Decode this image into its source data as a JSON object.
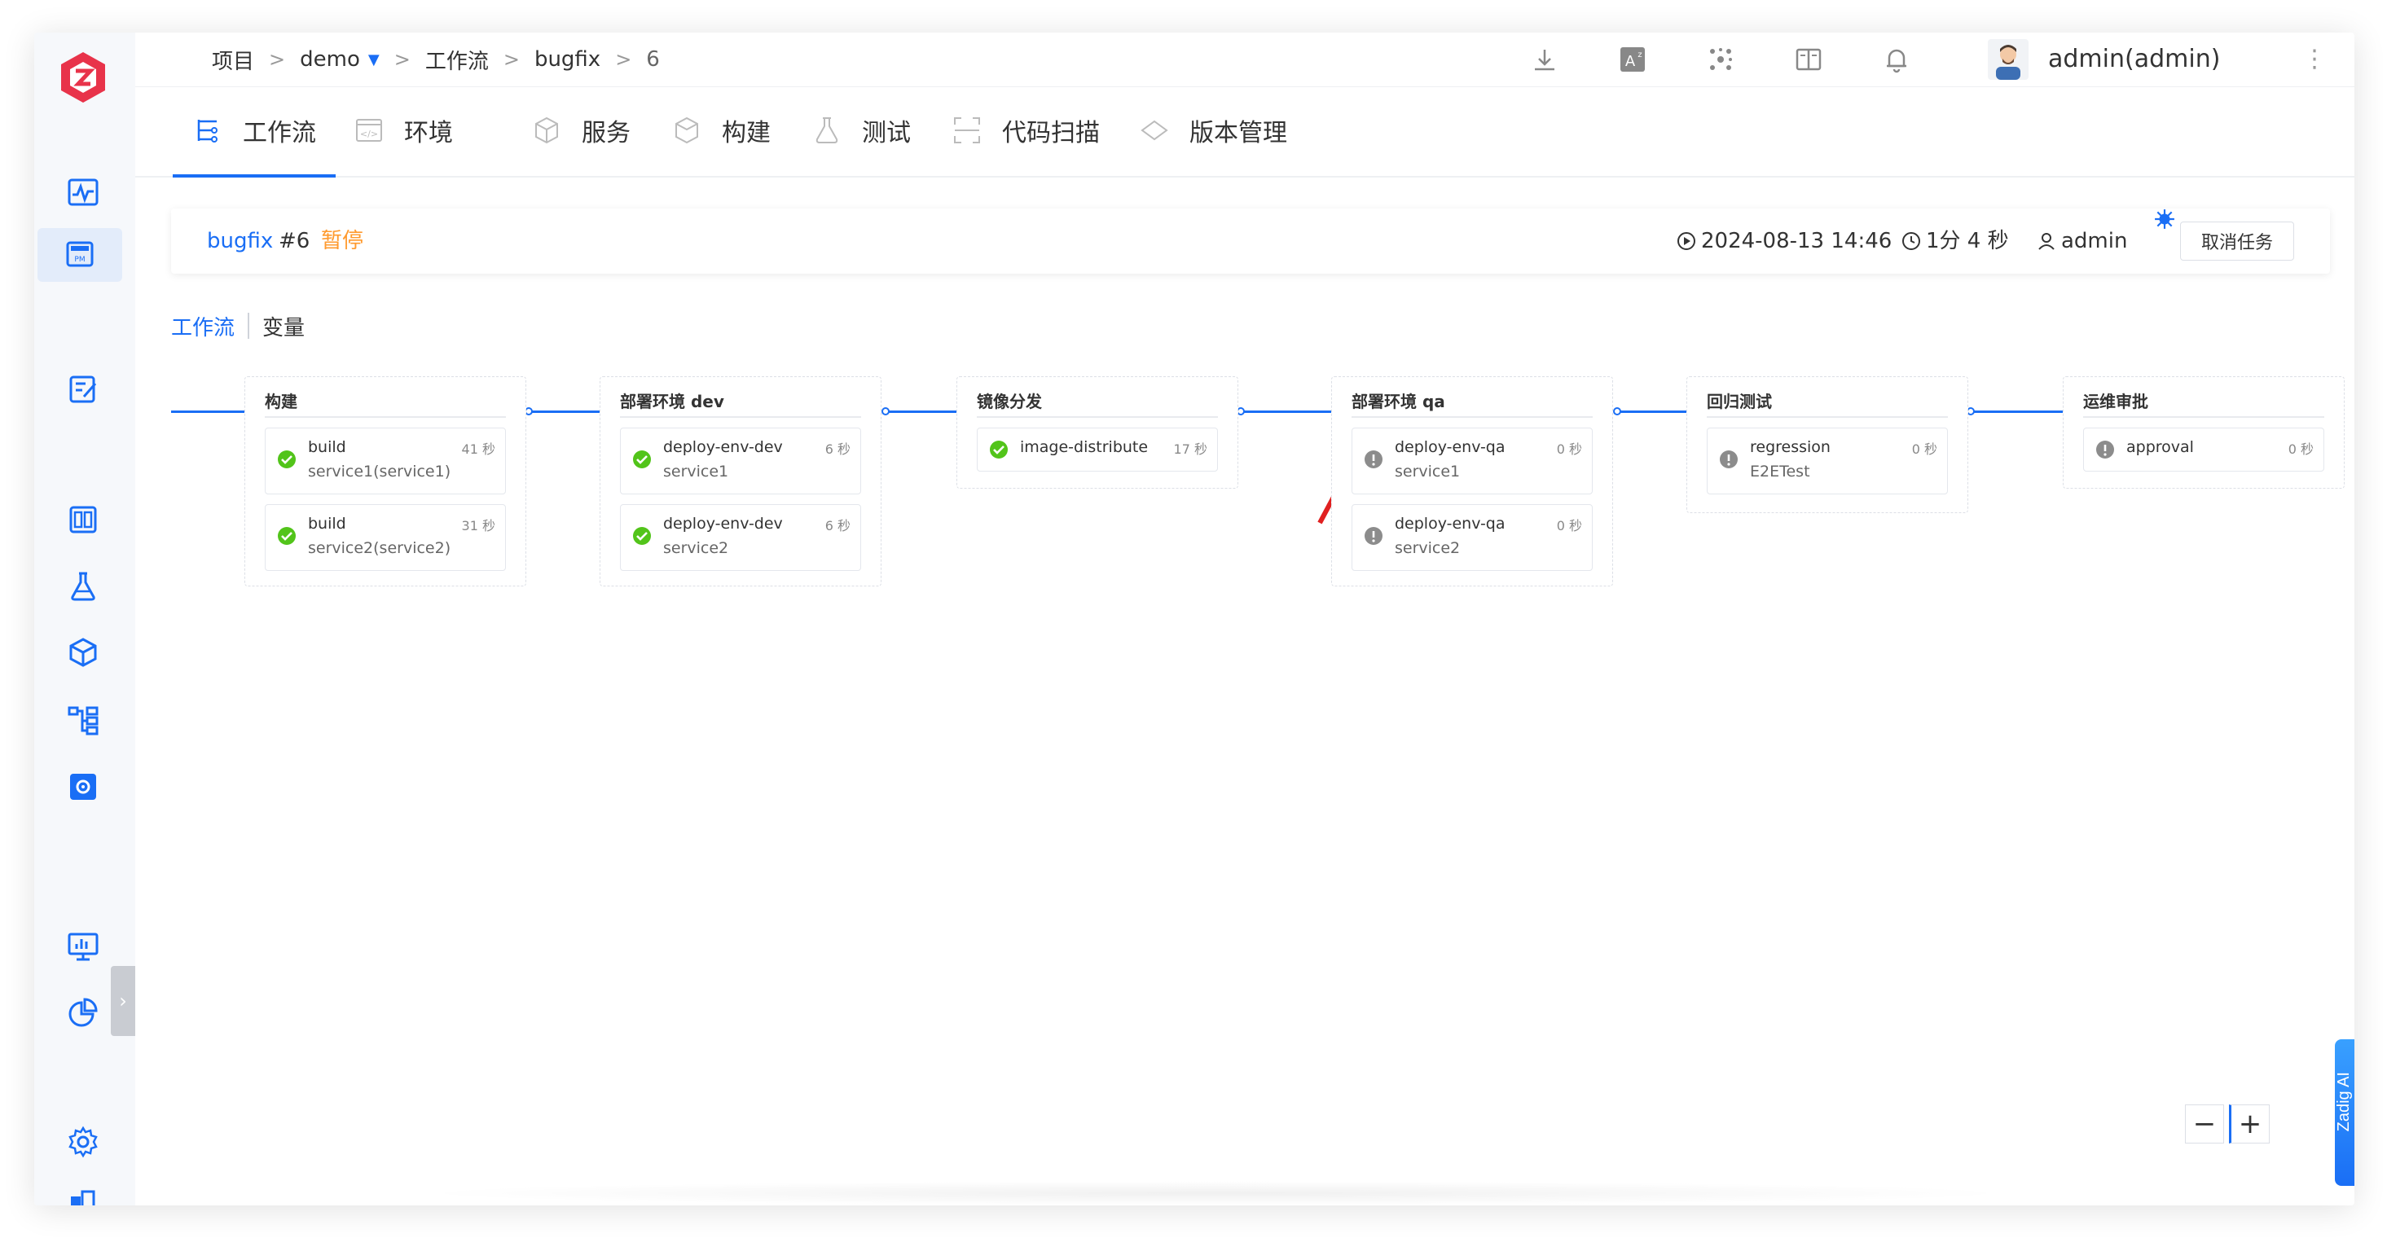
{
  "breadcrumb": {
    "project": "项目",
    "demo": "demo",
    "workflow": "工作流",
    "bugfix": "bugfix",
    "run": "6",
    "sep": ">"
  },
  "user": {
    "name": "admin(admin)"
  },
  "tabs": [
    {
      "label": "工作流"
    },
    {
      "label": "环境"
    },
    {
      "label": "服务"
    },
    {
      "label": "构建"
    },
    {
      "label": "测试"
    },
    {
      "label": "代码扫描"
    },
    {
      "label": "版本管理"
    }
  ],
  "task": {
    "workflow": "bugfix",
    "number": "#6",
    "status": "暂停",
    "start_time": "2024-08-13 14:46",
    "duration": "1分 4 秒",
    "creator": "admin",
    "cancel_label": "取消任务"
  },
  "subtabs": {
    "workflow": "工作流",
    "variables": "变量"
  },
  "stages": [
    {
      "title": "构建",
      "jobs": [
        {
          "name": "build",
          "sub": "service1(service1)",
          "time": "41 秒",
          "status": "success"
        },
        {
          "name": "build",
          "sub": "service2(service2)",
          "time": "31 秒",
          "status": "success"
        }
      ]
    },
    {
      "title": "部署环境 dev",
      "jobs": [
        {
          "name": "deploy-env-dev",
          "sub": "service1",
          "time": "6 秒",
          "status": "success"
        },
        {
          "name": "deploy-env-dev",
          "sub": "service2",
          "time": "6 秒",
          "status": "success"
        }
      ]
    },
    {
      "title": "镜像分发",
      "jobs": [
        {
          "name": "image-distribute",
          "sub": "",
          "time": "17 秒",
          "status": "success"
        }
      ]
    },
    {
      "title": "部署环境 qa",
      "jobs": [
        {
          "name": "deploy-env-qa",
          "sub": "service1",
          "time": "0 秒",
          "status": "pending"
        },
        {
          "name": "deploy-env-qa",
          "sub": "service2",
          "time": "0 秒",
          "status": "pending"
        }
      ]
    },
    {
      "title": "回归测试",
      "jobs": [
        {
          "name": "regression",
          "sub": "E2ETest",
          "time": "0 秒",
          "status": "pending"
        }
      ]
    },
    {
      "title": "运维审批",
      "jobs": [
        {
          "name": "approval",
          "sub": "",
          "time": "0 秒",
          "status": "pending"
        }
      ]
    }
  ],
  "zoom": {
    "minus": "−",
    "plus": "+"
  },
  "assistant": {
    "label": "Zadig AI"
  },
  "colors": {
    "accent": "#1a6ef5",
    "success": "#52c41a",
    "pending": "#8c8c8c",
    "paused": "#ff9a2e",
    "logo": "#e8334a"
  }
}
